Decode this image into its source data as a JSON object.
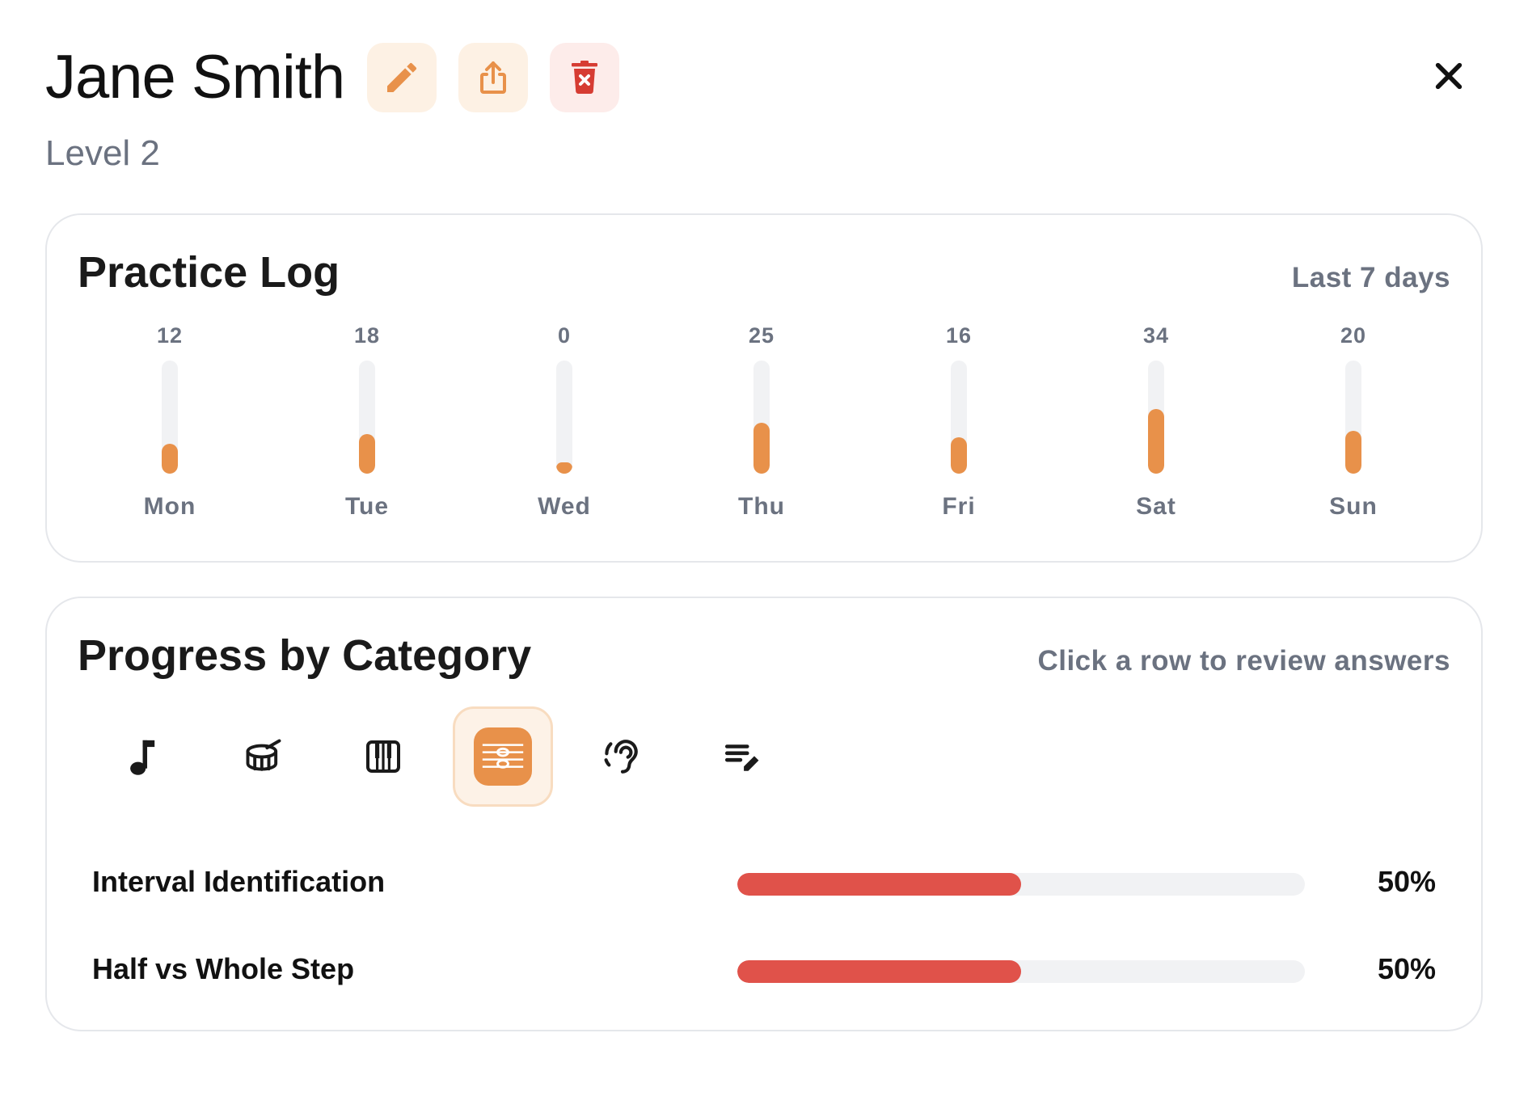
{
  "header": {
    "name": "Jane Smith",
    "level": "Level 2",
    "actions": {
      "edit_icon": "pencil-icon",
      "share_icon": "share-icon",
      "delete_icon": "trash-x-icon"
    },
    "close_icon": "close-icon"
  },
  "practice_log": {
    "title": "Practice Log",
    "range": "Last 7 days",
    "max_value": 34,
    "days": [
      {
        "label": "Mon",
        "value": "12",
        "minutes": 12
      },
      {
        "label": "Tue",
        "value": "18",
        "minutes": 18
      },
      {
        "label": "Wed",
        "value": "0",
        "minutes": 0
      },
      {
        "label": "Thu",
        "value": "25",
        "minutes": 25
      },
      {
        "label": "Fri",
        "value": "16",
        "minutes": 16
      },
      {
        "label": "Sat",
        "value": "34",
        "minutes": 34
      },
      {
        "label": "Sun",
        "value": "20",
        "minutes": 20
      }
    ]
  },
  "progress": {
    "title": "Progress by Category",
    "hint": "Click a row to review answers",
    "categories": [
      {
        "icon": "music-note-icon",
        "active": false
      },
      {
        "icon": "drum-icon",
        "active": false
      },
      {
        "icon": "piano-keys-icon",
        "active": false
      },
      {
        "icon": "staff-notes-icon",
        "active": true
      },
      {
        "icon": "ear-listening-icon",
        "active": false
      },
      {
        "icon": "list-edit-icon",
        "active": false
      }
    ],
    "rows": [
      {
        "label": "Interval Identification",
        "percent_text": "50%",
        "percent": 50
      },
      {
        "label": "Half vs Whole Step",
        "percent_text": "50%",
        "percent": 50
      }
    ]
  },
  "colors": {
    "accent": "#e8914a",
    "danger": "#e0524a",
    "muted": "#6b7280"
  }
}
